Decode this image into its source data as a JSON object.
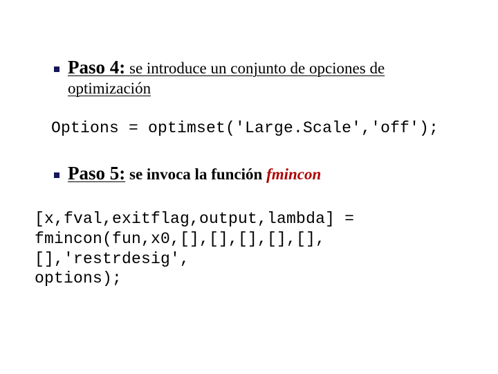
{
  "step4": {
    "label": "Paso 4:",
    "rest": " se introduce un conjunto de opciones de",
    "line2": "optimización"
  },
  "code1": "Options = optimset('Large.Scale','off');",
  "step5": {
    "label": "Paso 5:",
    "rest_prefix": " se invoca la función ",
    "fn": "fmincon"
  },
  "code2_line1": "[x,fval,exitflag,output,lambda] =",
  "code2_line2": "fmincon(fun,x0,[],[],[],[],[],[],'restrdesig',",
  "code2_line3": "options);"
}
